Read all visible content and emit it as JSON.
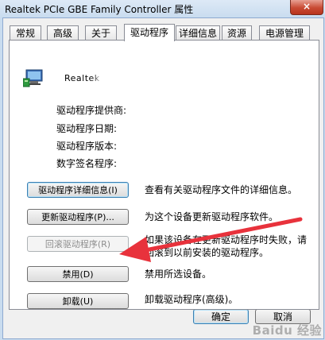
{
  "window": {
    "title": "Realtek PCIe GBE Family Controller 属性",
    "close_label": "×"
  },
  "tabs": [
    {
      "label": "常规",
      "active": false
    },
    {
      "label": "高级",
      "active": false
    },
    {
      "label": "关于",
      "active": false
    },
    {
      "label": "驱动程序",
      "active": true
    },
    {
      "label": "详细信息",
      "active": false
    },
    {
      "label": "资源",
      "active": false
    },
    {
      "label": "电源管理",
      "active": false
    }
  ],
  "driver": {
    "device_name": "Realtek",
    "properties": [
      {
        "label": "驱动程序提供商:"
      },
      {
        "label": "驱动程序日期:"
      },
      {
        "label": "驱动程序版本:"
      },
      {
        "label": "数字签名程序:"
      }
    ]
  },
  "actions": [
    {
      "button": "驱动程序详细信息(I)",
      "description": "查看有关驱动程序文件的详细信息。",
      "state": "focused"
    },
    {
      "button": "更新驱动程序(P)...",
      "description": "为这个设备更新驱动程序软件。",
      "state": "normal"
    },
    {
      "button": "回滚驱动程序(R)",
      "description": "如果该设备在更新驱动程序时失败，请回滚到以前安装的驱动程序。",
      "description_line1": "如果该设备在更新驱动程序时失败，请",
      "description_line2": "回滚到以前安装的驱动程序。",
      "state": "disabled"
    },
    {
      "button": "禁用(D)",
      "description": "禁用所选设备。",
      "state": "normal"
    },
    {
      "button": "卸载(U)",
      "description": "卸载驱动程序(高级)。",
      "state": "normal"
    }
  ],
  "footer": {
    "ok_label": "确定",
    "cancel_label": "取消"
  },
  "watermark": "Baidu 经验",
  "colors": {
    "annotation_arrow": "#e8323c",
    "titlebar": "#c9dcef",
    "close_button": "#c84a33"
  }
}
